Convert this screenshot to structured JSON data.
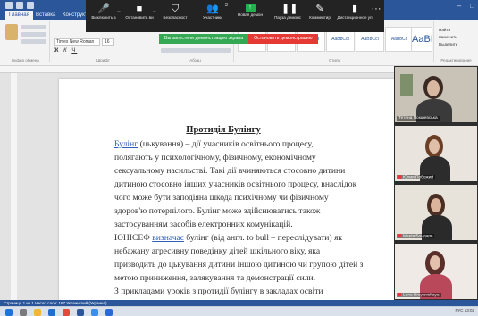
{
  "zoom_toolbar": {
    "items": [
      {
        "label": "Выключить з",
        "icon": "mic-icon"
      },
      {
        "label": "Остановить ви",
        "icon": "camera-icon"
      },
      {
        "label": "Безопасност",
        "icon": "shield-icon"
      },
      {
        "label": "Участники",
        "icon": "participants-icon"
      },
      {
        "label": "Новая демон",
        "icon": "share-screen-icon"
      },
      {
        "label": "Пауза демонс",
        "icon": "pause-icon"
      },
      {
        "label": "Комментир",
        "icon": "annotate-icon"
      },
      {
        "label": "Дистанционное уп",
        "icon": "remote-control-icon"
      },
      {
        "label": "Дополнит",
        "icon": "more-icon"
      }
    ],
    "participant_count": "3"
  },
  "share_banner": {
    "status": "Вы запустили демонстрацию экрана",
    "stop": "Остановить демонстрацию"
  },
  "word": {
    "tabs": [
      "Главная",
      "Вставка",
      "Конструктор",
      "Макет",
      "Ссылки",
      "Рассылки",
      "Рецензирование",
      "Вид",
      "Справка"
    ],
    "active_tab": "Главная",
    "font_name": "Times New Roman",
    "font_size": "16",
    "ribbon_groups": [
      "Буфер обмена",
      "Шрифт",
      "Абзац",
      "Стили",
      "Редактирование"
    ],
    "styles": [
      "АаБбВвГ",
      "АаБбВвГ",
      "АаБбВв",
      "AaBbCcI",
      "AaBbCcI",
      "AaBbCc",
      "AaBI"
    ],
    "style_names": [
      "Обычный",
      "Без инте...",
      "Заголовок 1",
      "Заголовок 2",
      "Заголовок 3",
      "Название"
    ],
    "editing": [
      "Найти",
      "Заменить",
      "Выделить"
    ],
    "status": "Страница 1 из 1   Число слов: 167   Украинский (Украина)"
  },
  "document": {
    "title": "Протидія Булінгу",
    "lines": [
      {
        "link": "Булінг",
        "text": " (цькування)  –  дії  учасників  освітнього  процесу,"
      },
      {
        "link": "",
        "text": "полягають  у  психологічному,  фізичному,  економічному"
      },
      {
        "link": "",
        "text": "сексуальному насильстві. Такі дії вчиняються стосовно дитини"
      },
      {
        "link": "",
        "text": "дитиною стосовно інших учасників освітнього процесу, внаслідок"
      },
      {
        "link": "",
        "text": "чого  може  бути  заподіяна  шкода  психічному  чи  фізичному"
      },
      {
        "link": "",
        "text": "здоров'ю  потерпілого.  Булінг  може  здійснюватись  також"
      },
      {
        "link": "",
        "text": "застосуванням засобів електронних комунікацій."
      },
      {
        "link": "визначає",
        "text": " булінг (від англ. to bull – переслідувати) як",
        "prefix": "ЮНІСЕФ "
      },
      {
        "link": "",
        "text": "небажану агресивну поведінку дітей шкільного віку, яка"
      },
      {
        "link": "",
        "text": "призводить до цькування дитини іншою дитиною чи групою дітей з"
      },
      {
        "link": "",
        "text": "метою приниження, залякування та демонстрації сили."
      },
      {
        "link": "",
        "text": "З прикладами уроків з протидії булінгу в закладах освіти"
      }
    ]
  },
  "participants": [
    {
      "name": "Тетяна Покшевська",
      "hair": "#3b2a24",
      "bg": "#c9c2b6",
      "shirt": "#3a3a3a",
      "mic_muted": false
    },
    {
      "name": "Юлия Побожий",
      "hair": "#6b3f25",
      "bg": "#e9e4dd",
      "shirt": "#2c2c2c",
      "mic_muted": true
    },
    {
      "name": "Марія Бондарь",
      "hair": "#4a2e23",
      "bg": "#e7e2da",
      "shirt": "#2a2a2a",
      "mic_muted": true
    },
    {
      "name": "Lena Braylovskaya",
      "hair": "#5a2f2a",
      "bg": "#efeae6",
      "shirt": "#b8485a",
      "mic_muted": true
    }
  ],
  "taskbar": {
    "time": "13:02",
    "date": "06.03.2022",
    "lang": "РУС"
  }
}
